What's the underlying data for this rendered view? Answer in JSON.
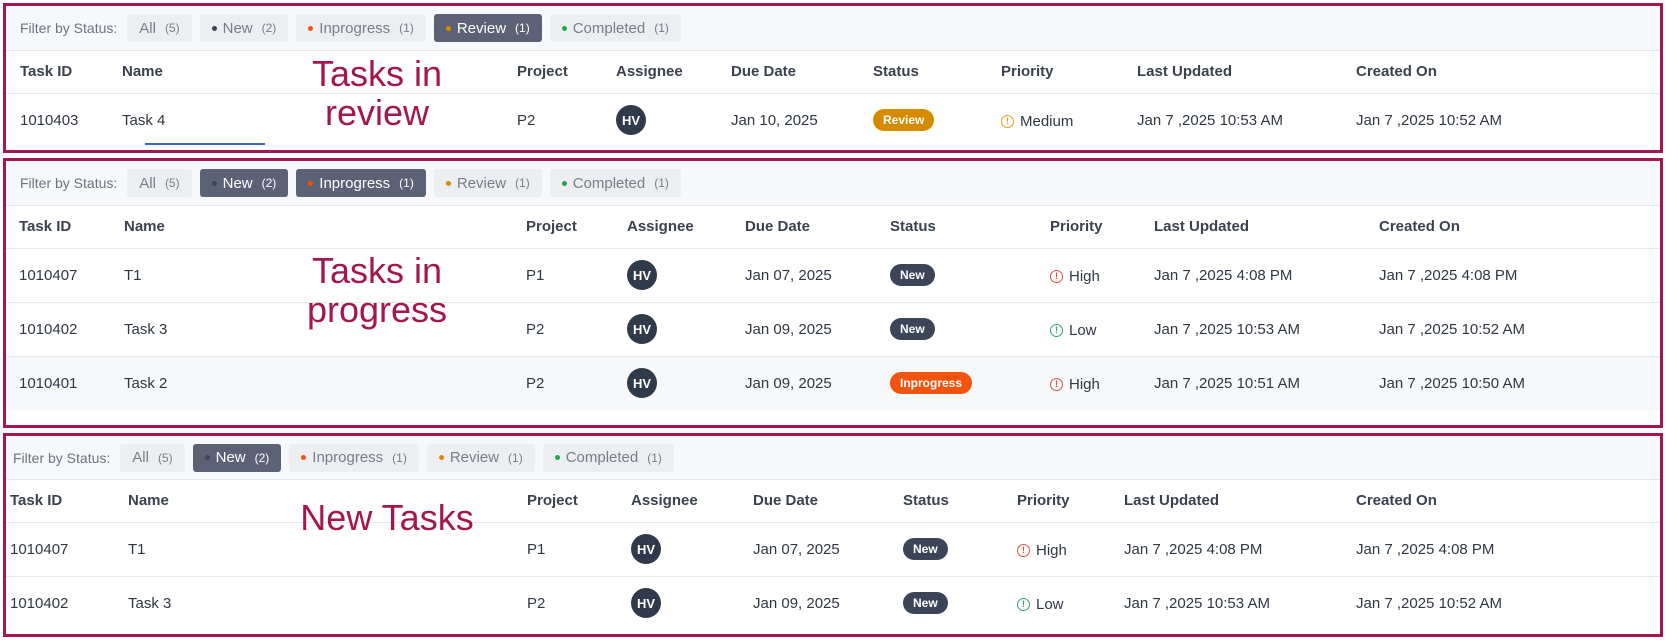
{
  "colors": {
    "annotation": "#a3164f",
    "chip_active_bg": "#5b6275",
    "status_new": "#3a4558",
    "status_review": "#d68a00",
    "status_inprogress": "#f0540e",
    "priority_high": "#d6504a",
    "priority_medium": "#e2a21a",
    "priority_low": "#2aa66e",
    "dot_new": "#3a4558",
    "dot_inprogress": "#f0540e",
    "dot_review": "#d68a00",
    "dot_completed": "#1fa844"
  },
  "filter_label": "Filter by Status:",
  "headers": [
    "Task ID",
    "Name",
    "Project",
    "Assignee",
    "Due Date",
    "Status",
    "Priority",
    "Last Updated",
    "Created On"
  ],
  "panels": {
    "review": {
      "annotation": "Tasks in review",
      "filters": [
        {
          "label": "All",
          "count": "(5)",
          "active": false
        },
        {
          "label": "New",
          "count": "(2)",
          "active": false
        },
        {
          "label": "Inprogress",
          "count": "(1)",
          "active": false
        },
        {
          "label": "Review",
          "count": "(1)",
          "active": true
        },
        {
          "label": "Completed",
          "count": "(1)",
          "active": false
        }
      ],
      "rows": [
        {
          "task_id": "1010403",
          "name": "Task 4",
          "project": "P2",
          "assignee": "HV",
          "due_date": "Jan 10, 2025",
          "status": "Review",
          "priority": "Medium",
          "last_updated": "Jan 7 ,2025 10:53 AM",
          "created_on": "Jan 7 ,2025 10:52 AM"
        }
      ]
    },
    "progress": {
      "annotation": "Tasks in progress",
      "filters": [
        {
          "label": "All",
          "count": "(5)",
          "active": false
        },
        {
          "label": "New",
          "count": "(2)",
          "active": true
        },
        {
          "label": "Inprogress",
          "count": "(1)",
          "active": true
        },
        {
          "label": "Review",
          "count": "(1)",
          "active": false
        },
        {
          "label": "Completed",
          "count": "(1)",
          "active": false
        }
      ],
      "rows": [
        {
          "task_id": "1010407",
          "name": "T1",
          "project": "P1",
          "assignee": "HV",
          "due_date": "Jan 07, 2025",
          "status": "New",
          "priority": "High",
          "last_updated": "Jan 7 ,2025 4:08 PM",
          "created_on": "Jan 7 ,2025 4:08 PM"
        },
        {
          "task_id": "1010402",
          "name": "Task 3",
          "project": "P2",
          "assignee": "HV",
          "due_date": "Jan 09, 2025",
          "status": "New",
          "priority": "Low",
          "last_updated": "Jan 7 ,2025 10:53 AM",
          "created_on": "Jan 7 ,2025 10:52 AM"
        },
        {
          "task_id": "1010401",
          "name": "Task 2",
          "project": "P2",
          "assignee": "HV",
          "due_date": "Jan 09, 2025",
          "status": "Inprogress",
          "priority": "High",
          "last_updated": "Jan 7 ,2025 10:51 AM",
          "created_on": "Jan 7 ,2025 10:50 AM"
        }
      ]
    },
    "new": {
      "annotation": "New Tasks",
      "filters": [
        {
          "label": "All",
          "count": "(5)",
          "active": false
        },
        {
          "label": "New",
          "count": "(2)",
          "active": true
        },
        {
          "label": "Inprogress",
          "count": "(1)",
          "active": false
        },
        {
          "label": "Review",
          "count": "(1)",
          "active": false
        },
        {
          "label": "Completed",
          "count": "(1)",
          "active": false
        }
      ],
      "rows": [
        {
          "task_id": "1010407",
          "name": "T1",
          "project": "P1",
          "assignee": "HV",
          "due_date": "Jan 07, 2025",
          "status": "New",
          "priority": "High",
          "last_updated": "Jan 7 ,2025 4:08 PM",
          "created_on": "Jan 7 ,2025 4:08 PM"
        },
        {
          "task_id": "1010402",
          "name": "Task 3",
          "project": "P2",
          "assignee": "HV",
          "due_date": "Jan 09, 2025",
          "status": "New",
          "priority": "Low",
          "last_updated": "Jan 7 ,2025 10:53 AM",
          "created_on": "Jan 7 ,2025 10:52 AM"
        }
      ]
    }
  }
}
